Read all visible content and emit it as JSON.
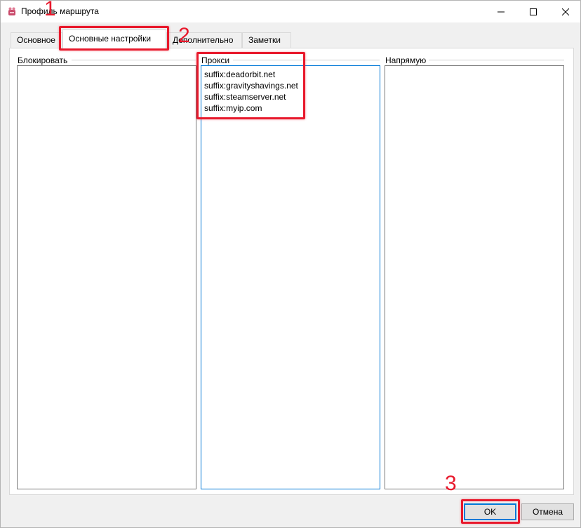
{
  "window": {
    "title": "Профиль маршрута",
    "controls": {
      "minimize": "minimize-icon",
      "maximize": "maximize-icon",
      "close": "close-icon"
    }
  },
  "tabs": [
    {
      "label": "Основное",
      "active": false
    },
    {
      "label": "Основные настройки",
      "active": true
    },
    {
      "label": "Дополнительно",
      "active": false
    },
    {
      "label": "Заметки",
      "active": false
    }
  ],
  "groups": {
    "block": {
      "label": "Блокировать",
      "items": []
    },
    "proxy": {
      "label": "Прокси",
      "items": [
        "suffix:deadorbit.net",
        "suffix:gravityshavings.net",
        "suffix:steamserver.net",
        "suffix:myip.com"
      ]
    },
    "direct": {
      "label": "Напрямую",
      "items": []
    }
  },
  "buttons": {
    "ok": "OK",
    "cancel": "Отмена"
  },
  "annotations": {
    "step1": "1",
    "step2": "2",
    "step3": "3"
  },
  "colors": {
    "highlight": "#e8192c",
    "focus": "#0078d7"
  }
}
